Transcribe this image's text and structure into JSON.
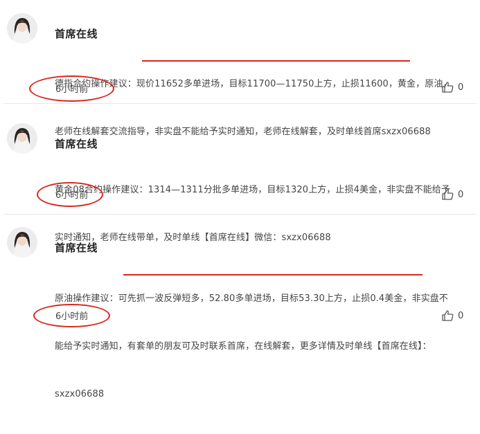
{
  "posts": [
    {
      "author": "首席在线",
      "lines": [
        "德指合约操作建议：现价11652多单进场，目标11700—11750上方，止损11600，黄金，原油，",
        "老师在线解套交流指导，非实盘不能给予实时通知，老师在线解套，及时单线首席sxzx06688"
      ],
      "time": "6小时前",
      "likes": "0"
    },
    {
      "author": "首席在线",
      "lines": [
        "黄金08合约操作建议：1314—1311分批多单进场，目标1320上方，止损4美金，非实盘不能给予",
        "实时通知，老师在线带单，及时单线【首席在线】微信：sxzx06688"
      ],
      "time": "6小时前",
      "likes": "0"
    },
    {
      "author": "首席在线",
      "lines": [
        "原油操作建议：可先抓一波反弹短多，52.80多单进场，目标53.30上方，止损0.4美金，非实盘不",
        "能给予实时通知，有套单的朋友可及时联系首席，在线解套，更多详情及时单线【首席在线】：",
        "sxzx06688"
      ],
      "time": "6小时前",
      "likes": "0"
    }
  ],
  "icons": {
    "like": "thumbs-up-icon",
    "avatar": "woman-portrait"
  },
  "colors": {
    "annotation": "#d8261e",
    "divider": "#e6e6e6"
  }
}
